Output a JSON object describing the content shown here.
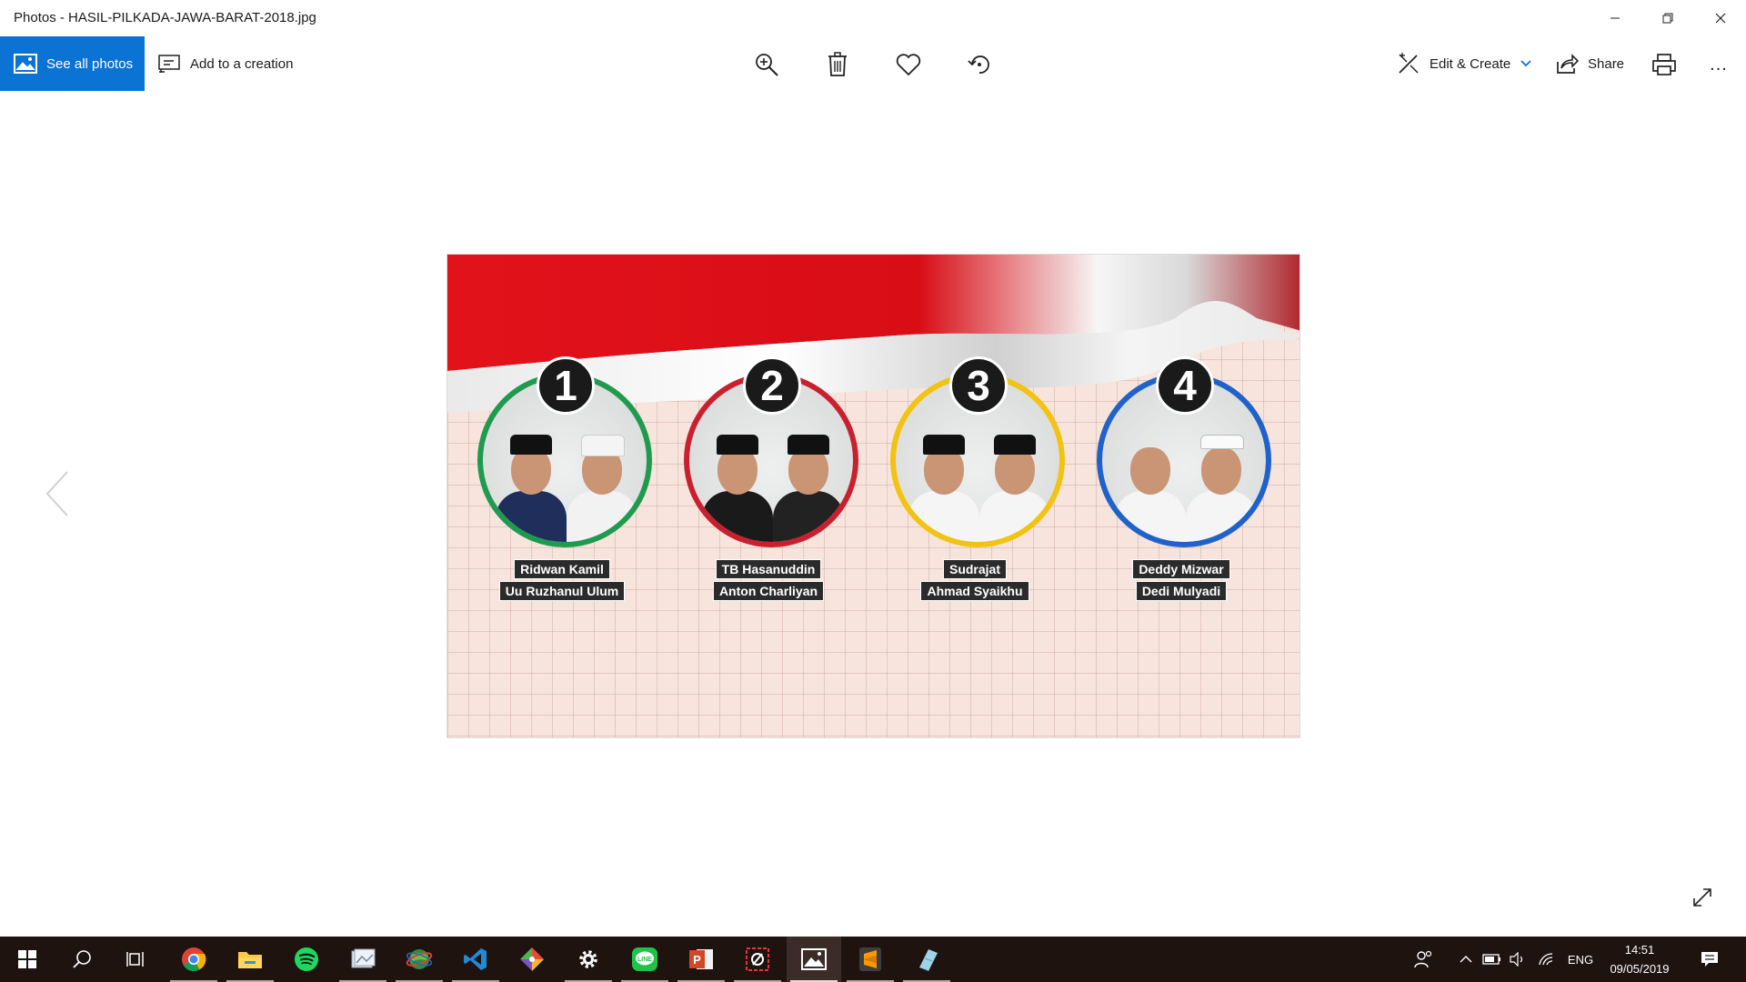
{
  "window": {
    "title": "Photos - HASIL-PILKADA-JAWA-BARAT-2018.jpg"
  },
  "toolbar": {
    "see_all_label": "See all photos",
    "add_creation_label": "Add to a creation",
    "edit_create_label": "Edit & Create",
    "share_label": "Share",
    "more_label": "..."
  },
  "photo": {
    "candidates": [
      {
        "number": "1",
        "name1": "Ridwan Kamil",
        "name2": "Uu Ruzhanul Ulum",
        "ring_color": "#1f9a4f"
      },
      {
        "number": "2",
        "name1": "TB Hasanuddin",
        "name2": "Anton Charliyan",
        "ring_color": "#c8202f"
      },
      {
        "number": "3",
        "name1": "Sudrajat",
        "name2": "Ahmad Syaikhu",
        "ring_color": "#f2c312"
      },
      {
        "number": "4",
        "name1": "Deddy Mizwar",
        "name2": "Dedi Mulyadi",
        "ring_color": "#1f62c9"
      }
    ]
  },
  "taskbar": {
    "apps": [
      "start-icon",
      "search-icon",
      "task-view-icon",
      "chrome-icon",
      "file-explorer-icon",
      "spotify-icon",
      "photo-viewer-icon",
      "network-globe-icon",
      "vscode-icon",
      "git-icon",
      "settings-icon",
      "line-icon",
      "powerpoint-icon",
      "snipping-icon",
      "photos-icon",
      "sublime-text-icon",
      "notepad-icon"
    ],
    "language": "ENG",
    "time": "14:51",
    "date": "09/05/2019"
  }
}
